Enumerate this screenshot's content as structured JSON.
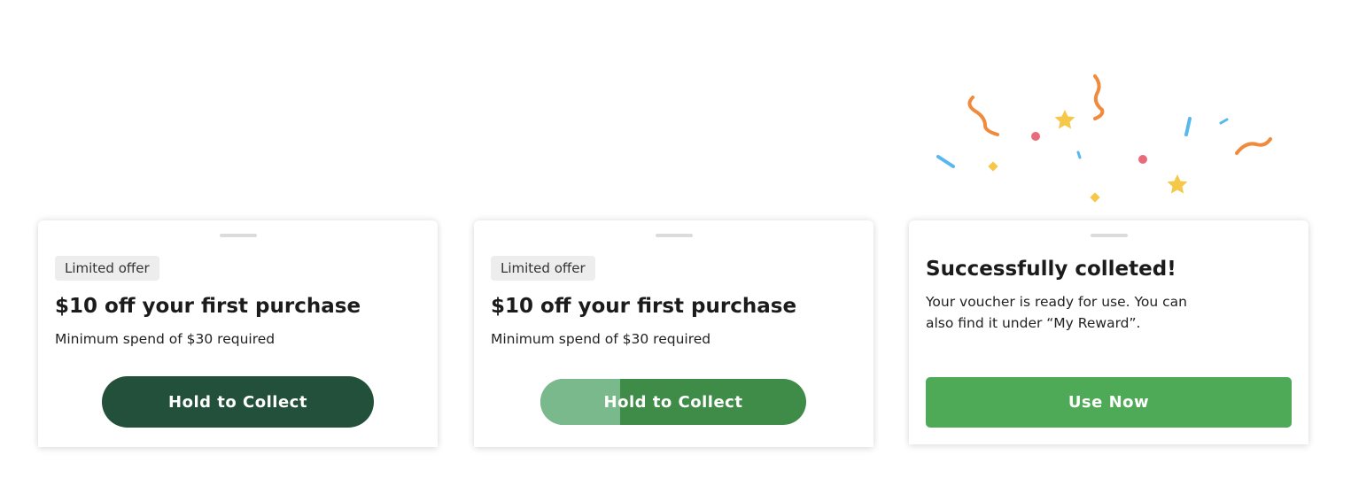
{
  "colors": {
    "dark_green": "#23503a",
    "hold_green": "#3f8b48",
    "hold_fill_light": "#7ab98c",
    "use_now_green": "#4faa57",
    "confetti": [
      "#f08a3c",
      "#f5c84a",
      "#e96a7a",
      "#56b8ee"
    ]
  },
  "icons": [
    "confetti-decoration"
  ],
  "cards": [
    {
      "badge": "Limited offer",
      "title": "$10 off your first purchase",
      "subtitle": "Minimum spend of $30 required",
      "button_label": "Hold to Collect"
    },
    {
      "badge": "Limited offer",
      "title": "$10 off your first purchase",
      "subtitle": "Minimum spend of $30 required",
      "button_label": "Hold to Collect",
      "hold_progress": 0.3
    },
    {
      "title": "Successfully colleted!",
      "body": "Your voucher is ready for use. You can also find it under “My Reward”.",
      "button_label": "Use Now"
    }
  ]
}
